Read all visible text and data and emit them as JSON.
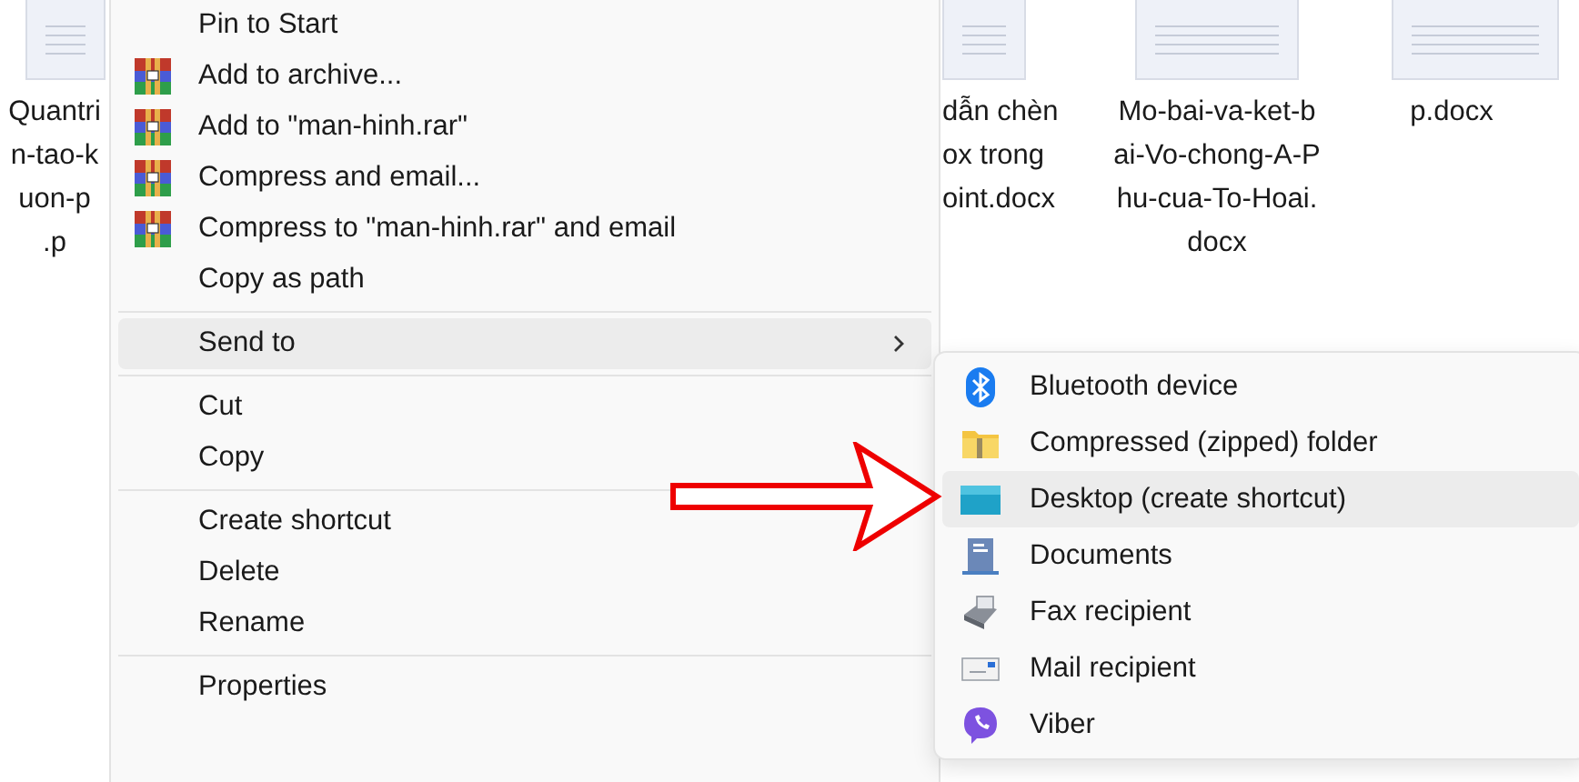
{
  "files": [
    {
      "name_lines": [
        "Quantri",
        "n-tao-k",
        "uon-p",
        ".p"
      ]
    },
    {
      "name_lines": [
        "dẫn chèn",
        "ox trong",
        "oint.docx"
      ]
    },
    {
      "name_lines": [
        "Mo-bai-va-ket-b",
        "ai-Vo-chong-A-P",
        "hu-cua-To-Hoai.",
        "docx"
      ]
    },
    {
      "name_lines": [
        "p.docx"
      ]
    }
  ],
  "context_menu": {
    "items": [
      {
        "kind": "plain",
        "label": "Pin to Start",
        "selected": false
      },
      {
        "kind": "archive",
        "label": "Add to archive...",
        "selected": false
      },
      {
        "kind": "archive",
        "label": "Add to \"man-hinh.rar\"",
        "selected": false
      },
      {
        "kind": "archive",
        "label": "Compress and email...",
        "selected": false
      },
      {
        "kind": "archive",
        "label": "Compress to \"man-hinh.rar\" and email",
        "selected": false
      },
      {
        "kind": "plain",
        "label": "Copy as path",
        "selected": false
      },
      {
        "kind": "separator"
      },
      {
        "kind": "submenu",
        "label": "Send to",
        "selected": true
      },
      {
        "kind": "separator"
      },
      {
        "kind": "plain",
        "label": "Cut",
        "selected": false
      },
      {
        "kind": "plain",
        "label": "Copy",
        "selected": false
      },
      {
        "kind": "separator"
      },
      {
        "kind": "plain",
        "label": "Create shortcut",
        "selected": false
      },
      {
        "kind": "plain",
        "label": "Delete",
        "selected": false
      },
      {
        "kind": "plain",
        "label": "Rename",
        "selected": false
      },
      {
        "kind": "separator"
      },
      {
        "kind": "plain",
        "label": "Properties",
        "selected": false
      }
    ]
  },
  "send_to_menu": {
    "items": [
      {
        "label": "Bluetooth device",
        "selected": false
      },
      {
        "label": "Compressed (zipped) folder",
        "selected": false
      },
      {
        "label": "Desktop (create shortcut)",
        "selected": true
      },
      {
        "label": "Documents",
        "selected": false
      },
      {
        "label": "Fax recipient",
        "selected": false
      },
      {
        "label": "Mail recipient",
        "selected": false
      },
      {
        "label": "Viber",
        "selected": false
      }
    ]
  },
  "annotation": {
    "kind": "arrow"
  }
}
